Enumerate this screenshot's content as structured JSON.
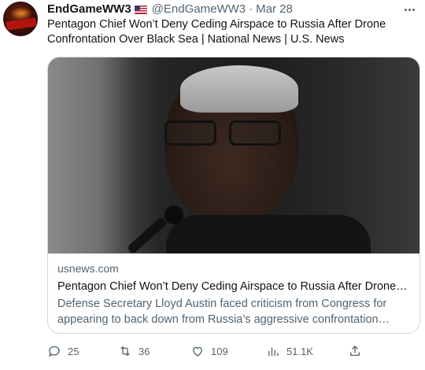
{
  "author": {
    "display_name": "EndGameWW3",
    "flag_icon": "us-flag-icon",
    "handle": "@EndGameWW3",
    "separator": "·",
    "date": "Mar 28"
  },
  "tweet": {
    "text": "Pentagon Chief Won’t Deny Ceding Airspace to Russia After Drone Confrontation Over Black Sea | National News | U.S. News"
  },
  "card": {
    "domain": "usnews.com",
    "title": "Pentagon Chief Won’t Deny Ceding Airspace to Russia After Drone C...",
    "description": "Defense Secretary Lloyd Austin faced criticism from Congress for appearing to back down from Russia’s aggressive confrontation with..."
  },
  "actions": {
    "replies": "25",
    "retweets": "36",
    "likes": "109",
    "views": "51.1K"
  },
  "colors": {
    "text_primary": "#0f1419",
    "text_secondary": "#536471",
    "border": "#cfd9de"
  }
}
